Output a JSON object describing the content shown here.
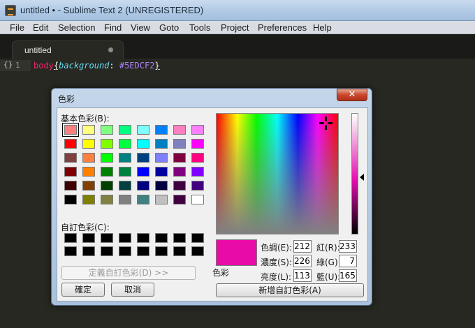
{
  "window": {
    "title": "untitled • - Sublime Text 2 (UNREGISTERED)",
    "app_icon": "sublime-text-icon"
  },
  "menubar": {
    "items": [
      "File",
      "Edit",
      "Selection",
      "Find",
      "View",
      "Goto",
      "Tools",
      "Project",
      "Preferences",
      "Help"
    ]
  },
  "tabs": [
    {
      "label": "untitled",
      "dirty": true
    }
  ],
  "editor": {
    "fold_icon": "{}",
    "line_number": "1",
    "code": {
      "selector": "body",
      "open_brace": "{",
      "property": "background",
      "colon": ": ",
      "value": "#5EDCF2",
      "close_brace": "}"
    },
    "theme": {
      "background": "#272822",
      "selector": "#f92672",
      "property": "#66d9ef",
      "value": "#ae81ff"
    }
  },
  "color_dialog": {
    "title": "色彩",
    "close_label": "✕",
    "basic_colors_label": "基本色彩(B):",
    "basic_colors": [
      [
        "#ff8080",
        "#ffff80",
        "#80ff80",
        "#00ff80",
        "#80ffff",
        "#0080ff",
        "#ff80c0",
        "#ff80ff"
      ],
      [
        "#ff0000",
        "#ffff00",
        "#80ff00",
        "#00ff40",
        "#00ffff",
        "#0080c0",
        "#8080c0",
        "#ff00ff"
      ],
      [
        "#804040",
        "#ff8040",
        "#00ff00",
        "#008080",
        "#004080",
        "#8080ff",
        "#800040",
        "#ff0080"
      ],
      [
        "#800000",
        "#ff8000",
        "#008000",
        "#008040",
        "#0000ff",
        "#0000a0",
        "#800080",
        "#8000ff"
      ],
      [
        "#400000",
        "#804000",
        "#004000",
        "#004040",
        "#000080",
        "#000040",
        "#400040",
        "#400080"
      ],
      [
        "#000000",
        "#808000",
        "#808040",
        "#808080",
        "#408080",
        "#c0c0c0",
        "#400040",
        "#ffffff"
      ]
    ],
    "selected_basic": "#ff8080",
    "custom_colors_label": "自訂色彩(C):",
    "custom_colors": [
      [
        "#000000",
        "#000000",
        "#000000",
        "#000000",
        "#000000",
        "#000000",
        "#000000",
        "#000000"
      ],
      [
        "#000000",
        "#000000",
        "#000000",
        "#000000",
        "#000000",
        "#000000",
        "#000000",
        "#000000"
      ]
    ],
    "define_custom_button": "定義自訂色彩(D) >>",
    "ok_button": "確定",
    "cancel_button": "取消",
    "preview_label": "色彩",
    "preview_color": "#e90ba5",
    "fields": {
      "hue_label": "色調(E):",
      "hue": "212",
      "sat_label": "濃度(S):",
      "sat": "226",
      "lum_label": "亮度(L):",
      "lum": "113",
      "red_label": "紅(R):",
      "red": "233",
      "green_label": "綠(G):",
      "green": "7",
      "blue_label": "藍(U):",
      "blue": "165"
    },
    "add_custom_button": "新增自訂色彩(A)"
  }
}
